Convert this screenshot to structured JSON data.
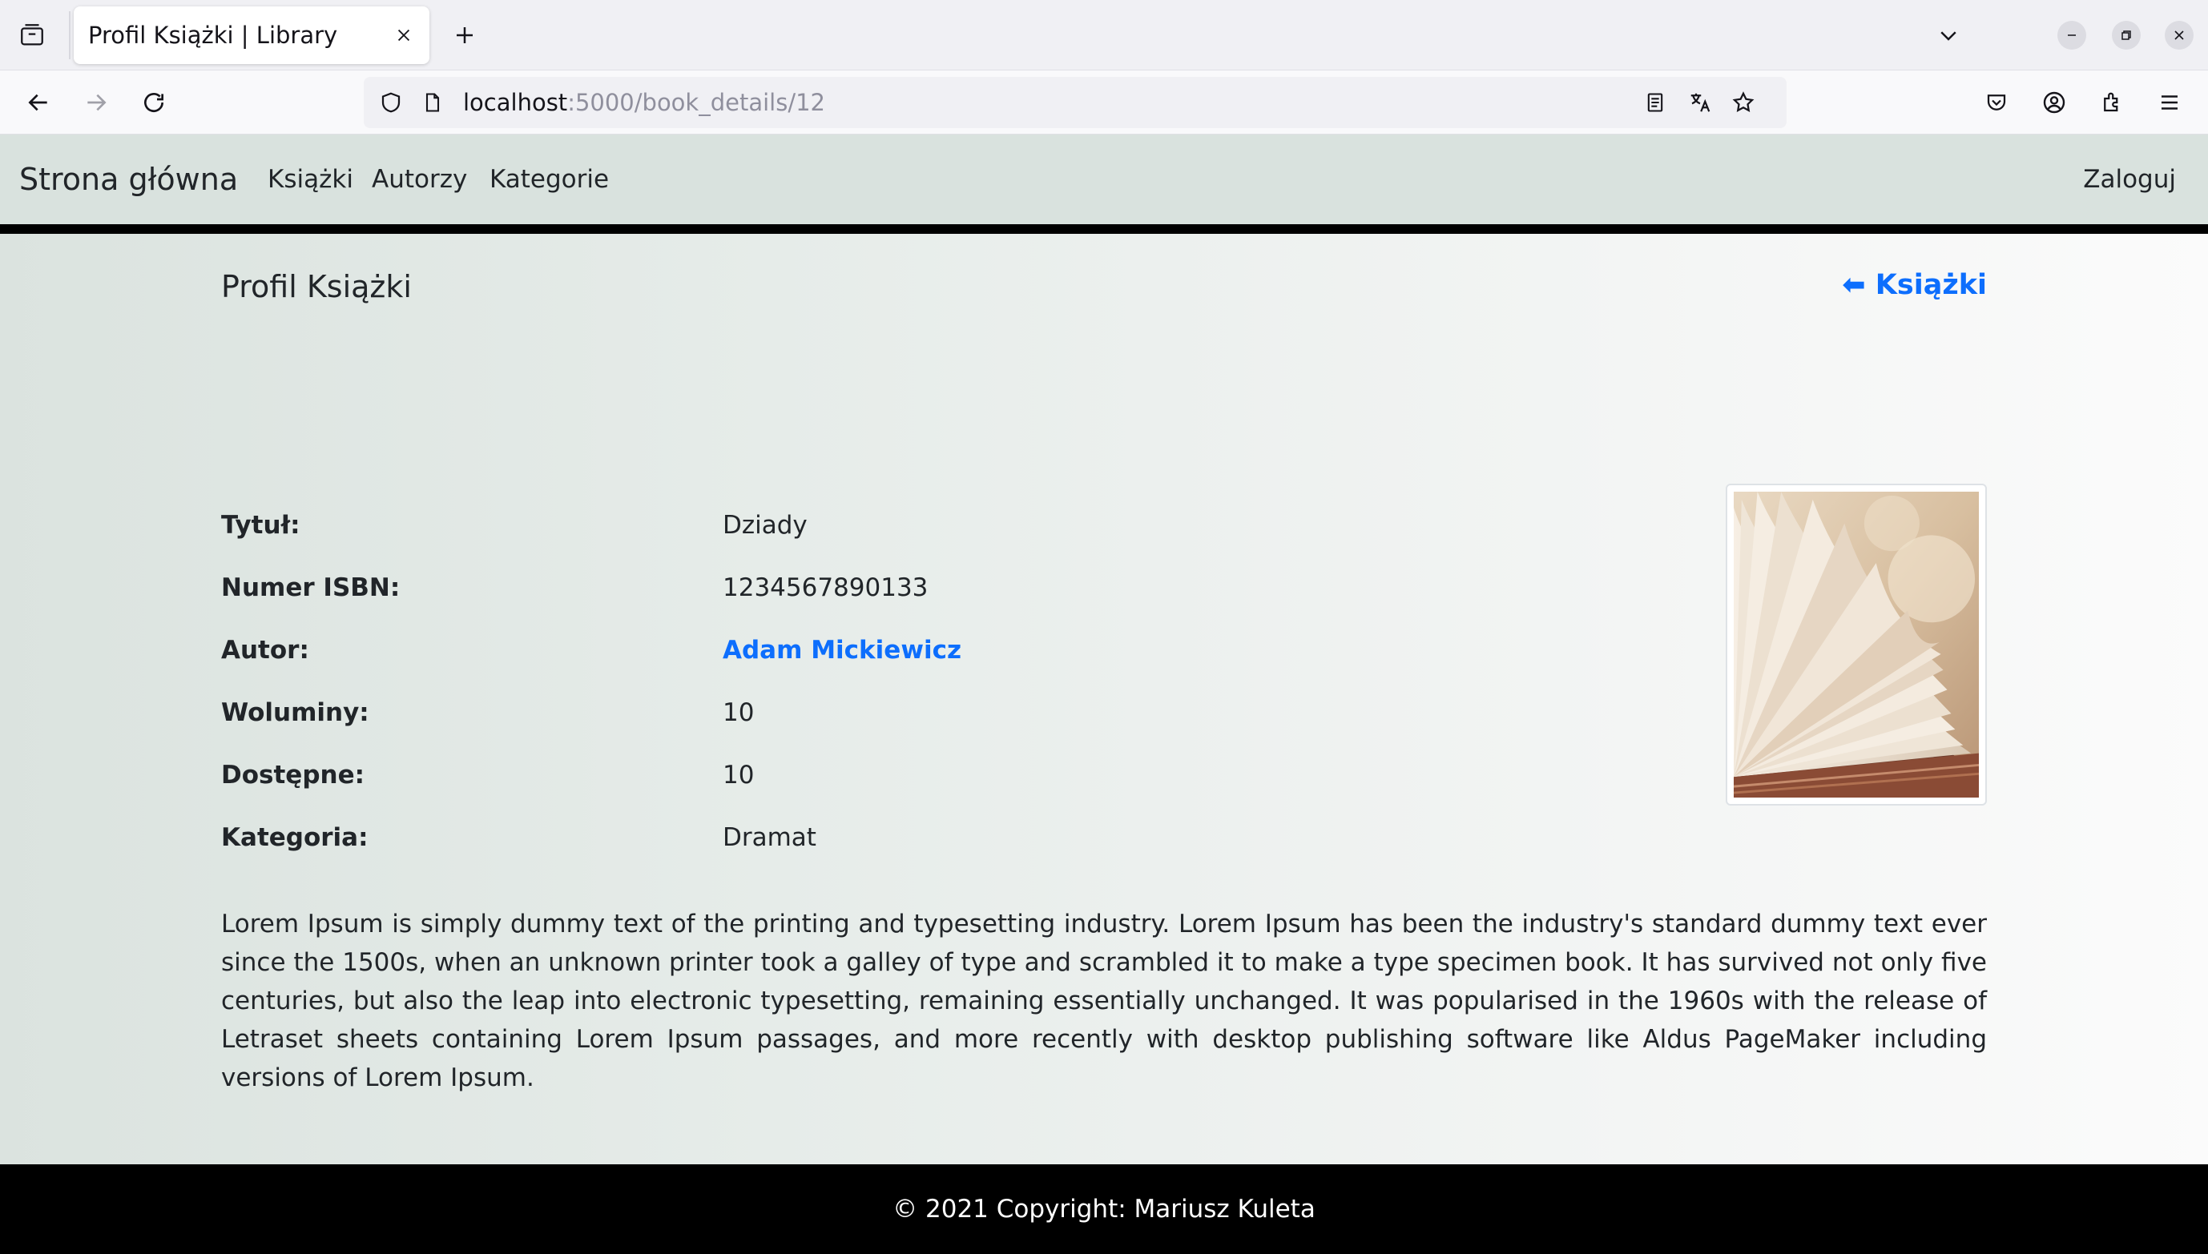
{
  "browser": {
    "tab_title": "Profil Książki | Library",
    "url_host": "localhost",
    "url_path": ":5000/book_details/12",
    "icons": [
      "tab-list-icon",
      "close-icon",
      "plus-icon",
      "chevron-down-icon",
      "minimize-icon",
      "restore-icon",
      "close-window-icon",
      "back-arrow-icon",
      "forward-arrow-icon",
      "reload-icon",
      "shield-icon",
      "page-icon",
      "reader-view-icon",
      "translate-icon",
      "star-icon",
      "pocket-icon",
      "account-icon",
      "extensions-icon",
      "menu-icon"
    ]
  },
  "nav": {
    "brand": "Strona główna",
    "links": [
      "Książki",
      "Autorzy",
      "Kategorie"
    ],
    "login": "Zaloguj"
  },
  "book": {
    "heading": "Profil Książki",
    "back_link": "⬅ Książki",
    "rows": [
      {
        "label": "Tytuł:",
        "value": "Dziady"
      },
      {
        "label": "Numer ISBN:",
        "value": "1234567890133"
      },
      {
        "label": "Autor:",
        "value": "Adam Mickiewicz"
      },
      {
        "label": "Woluminy:",
        "value": "10"
      },
      {
        "label": "Dostępne:",
        "value": "10"
      },
      {
        "label": "Kategoria:",
        "value": "Dramat"
      }
    ],
    "description": "Lorem Ipsum is simply dummy text of the printing and typesetting industry. Lorem Ipsum has been the industry's standard dummy text ever since the 1500s, when an unknown printer took a galley of type and scrambled it to make a type specimen book. It has survived not only five centuries, but also the leap into electronic typesetting, remaining essentially unchanged. It was popularised in the 1960s with the release of Letraset sheets containing Lorem Ipsum passages, and more recently with desktop publishing software like Aldus PageMaker including versions of Lorem Ipsum."
  },
  "footer": {
    "text": "© 2021 Copyright: Mariusz Kuleta"
  },
  "colors": {
    "link": "#0d6efd",
    "navbar_bg": "#d9e2de",
    "footer_bg": "#000000"
  }
}
